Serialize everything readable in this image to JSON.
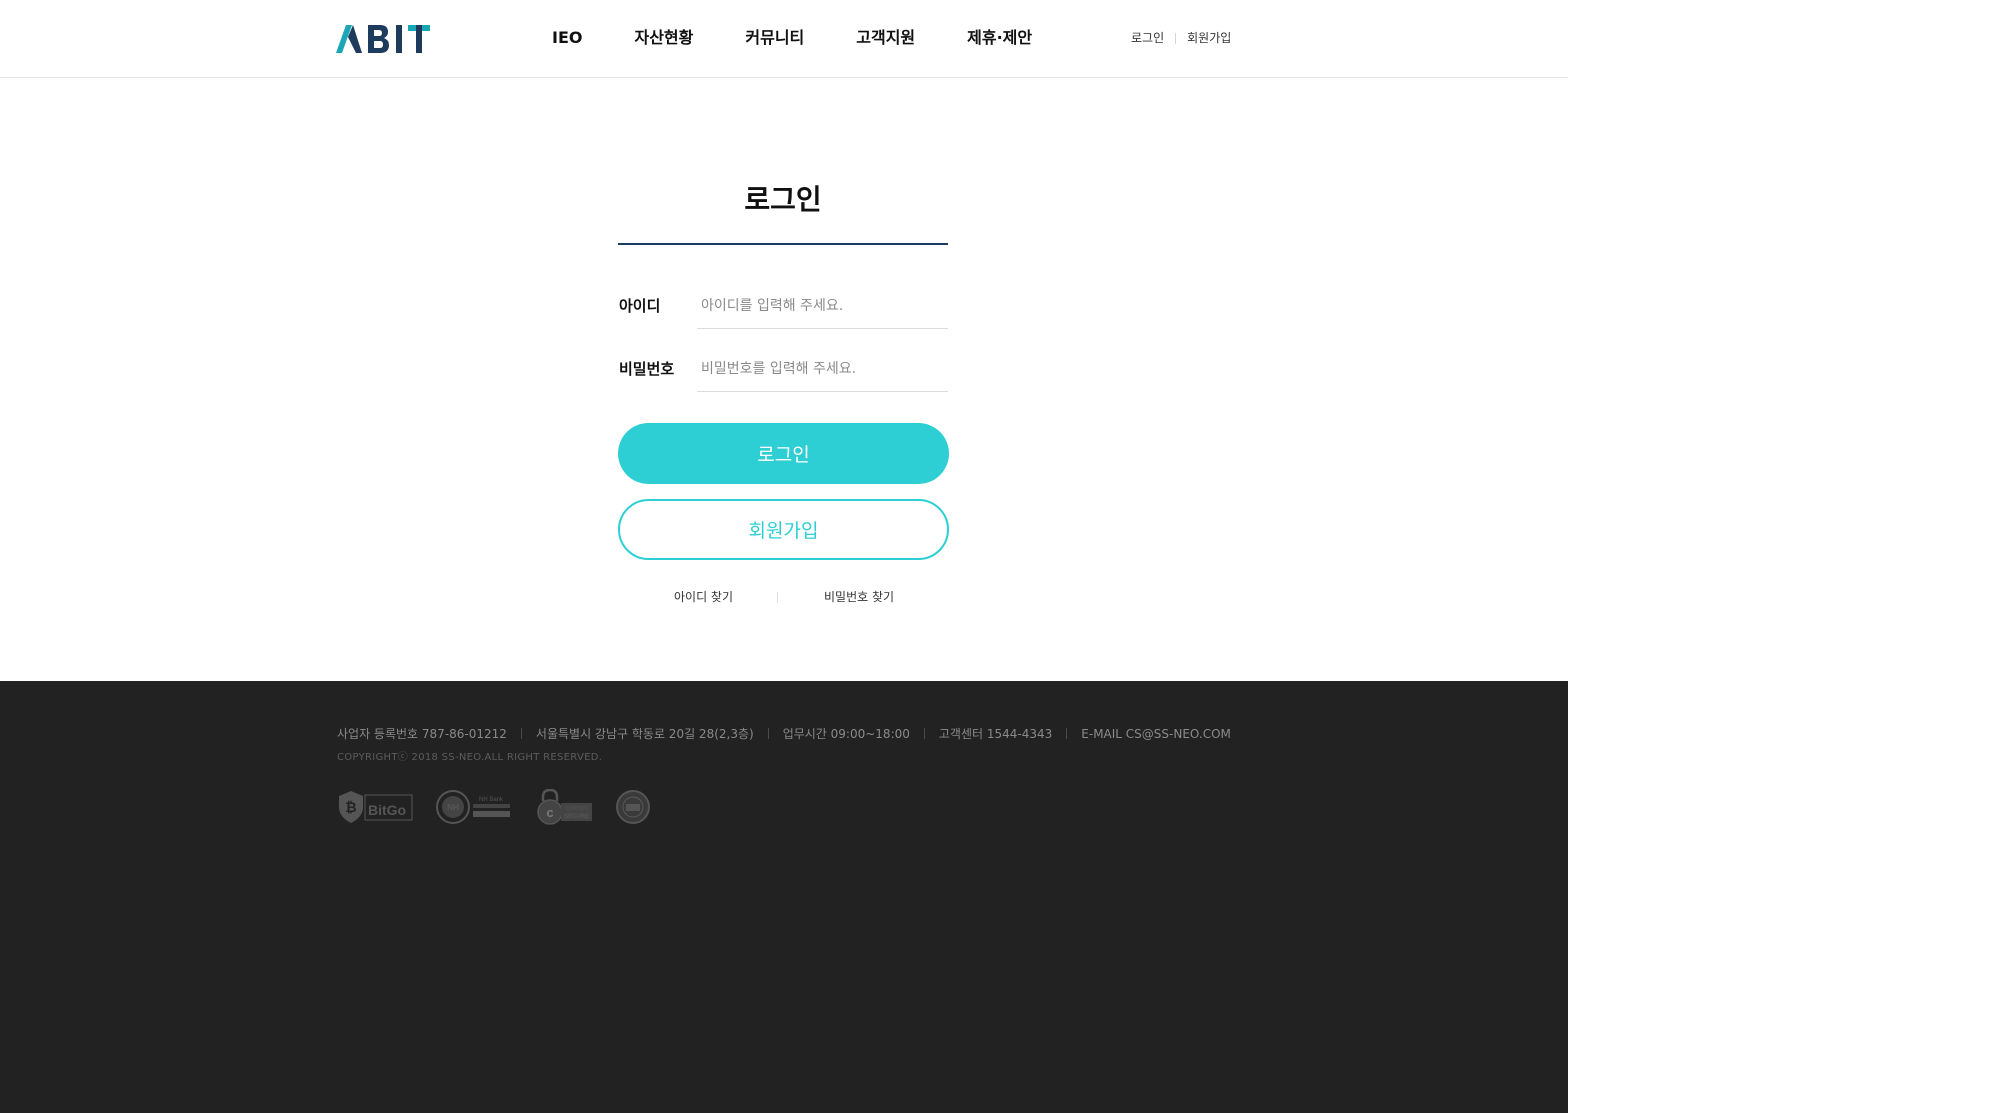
{
  "header": {
    "logo_text": "ABIT",
    "nav": [
      "IEO",
      "자산현황",
      "커뮤니티",
      "고객지원",
      "제휴·제안"
    ],
    "util": {
      "login": "로그인",
      "signup": "회원가입"
    }
  },
  "login": {
    "title": "로그인",
    "id_label": "아이디",
    "id_placeholder": "아이디를 입력해 주세요.",
    "pw_label": "비밀번호",
    "pw_placeholder": "비밀번호를 입력해 주세요.",
    "login_button": "로그인",
    "signup_button": "회원가입",
    "find_id": "아이디 찾기",
    "find_pw": "비밀번호 찾기"
  },
  "footer": {
    "business_no": "사업자 등록번호 787-86-01212",
    "address": "서울특별시 강남구 학동로 20길 28(2,3층)",
    "hours": "업무시간 09:00~18:00",
    "center": "고객센터 1544-4343",
    "email": "E-MAIL  CS@SS-NEO.COM",
    "copyright": "COPYRIGHTⓒ 2018 SS-NEO.ALL RIGHT RESERVED.",
    "badges": {
      "bitgo": "BitGo",
      "nh": "NH",
      "nh_bank": "NH Bank",
      "comodo_1": "COMODO",
      "comodo_2": "SECURE"
    }
  },
  "colors": {
    "accent": "#2dcfd4",
    "logo_dark": "#1d3b5c",
    "logo_teal": "#1aa6b4",
    "footer_bg": "#222222"
  }
}
